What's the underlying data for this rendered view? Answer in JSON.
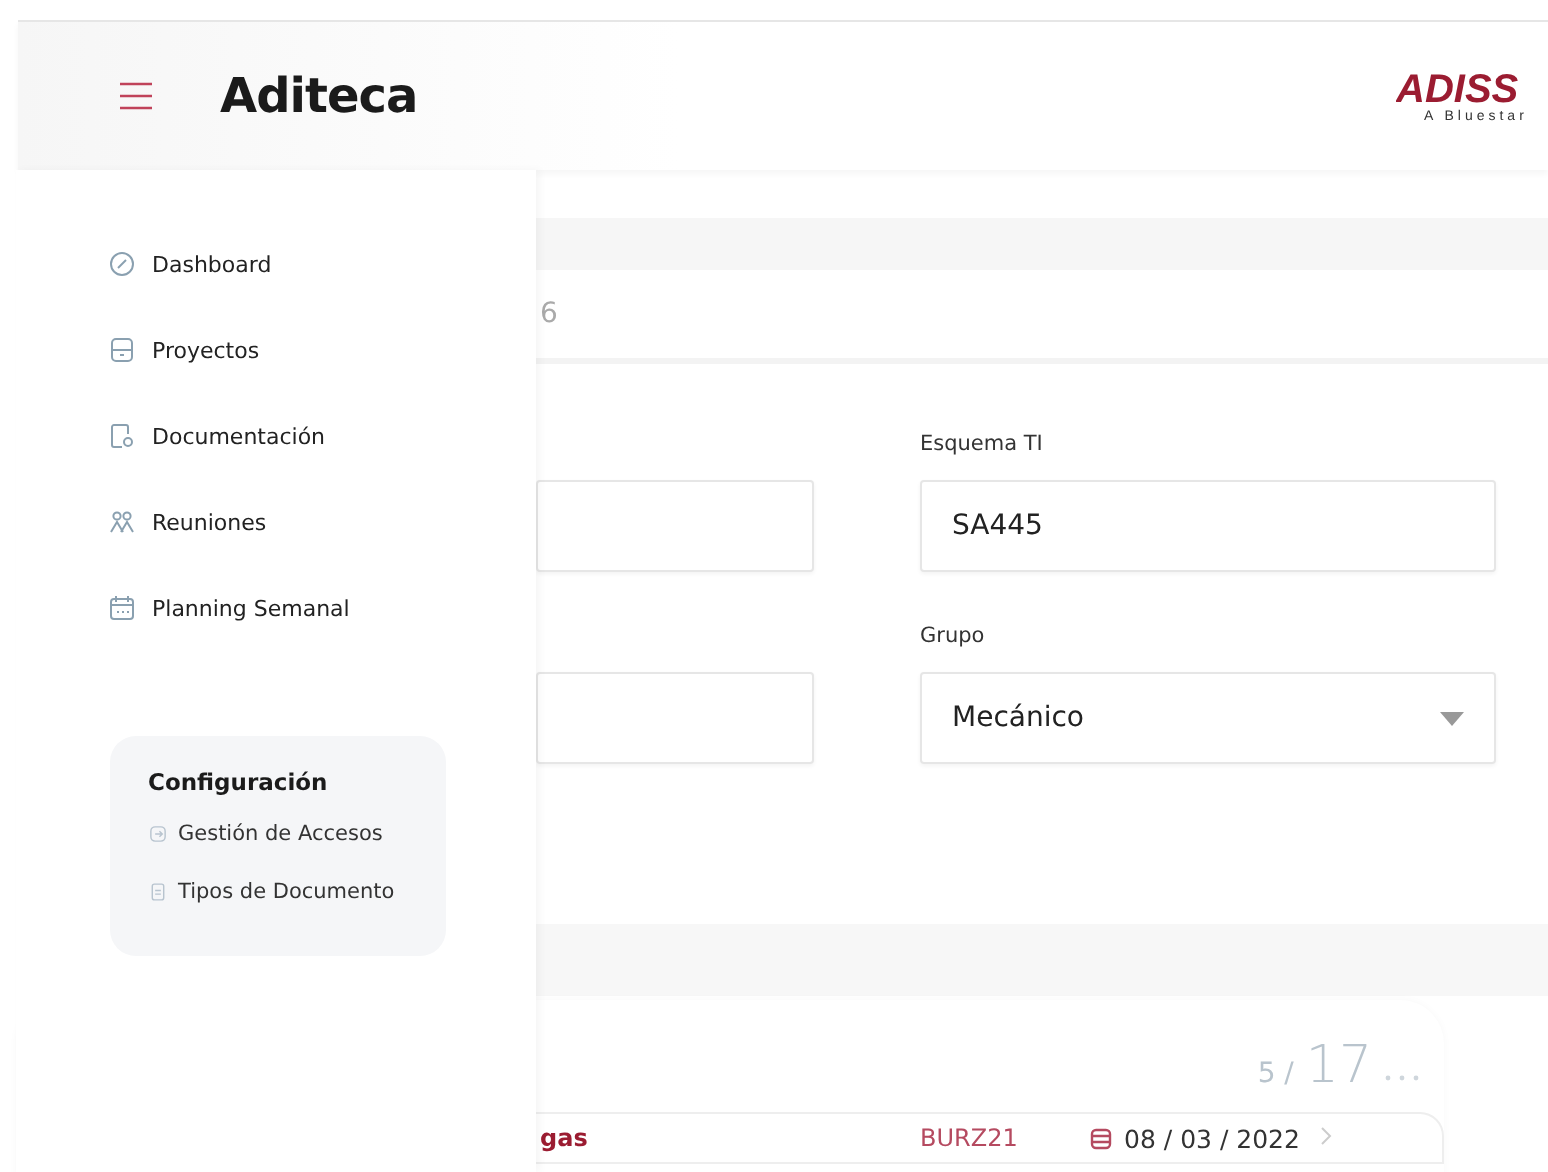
{
  "header": {
    "title": "Aditeca",
    "logo": "ADISS",
    "logo_tagline": "A Bluestar"
  },
  "menu": {
    "items": [
      {
        "label": "Dashboard"
      },
      {
        "label": "Proyectos"
      },
      {
        "label": "Documentación"
      },
      {
        "label": "Reuniones"
      },
      {
        "label": "Planning Semanal"
      }
    ],
    "config": {
      "title": "Configuración",
      "items": [
        {
          "label": "Gestión de Accesos"
        },
        {
          "label": "Tipos de Documento"
        }
      ]
    }
  },
  "form": {
    "top_value": "6",
    "fields": [
      {
        "label": "Esquema TI",
        "value": "SA445",
        "kind": "text"
      },
      {
        "label": "Grupo",
        "value": "Mecánico",
        "kind": "select"
      }
    ]
  },
  "list": {
    "page": "5 /",
    "total": "17",
    "rows": [
      {
        "name": "gas",
        "code": "BURZ21",
        "date": "08 / 03 / 2022"
      }
    ]
  }
}
